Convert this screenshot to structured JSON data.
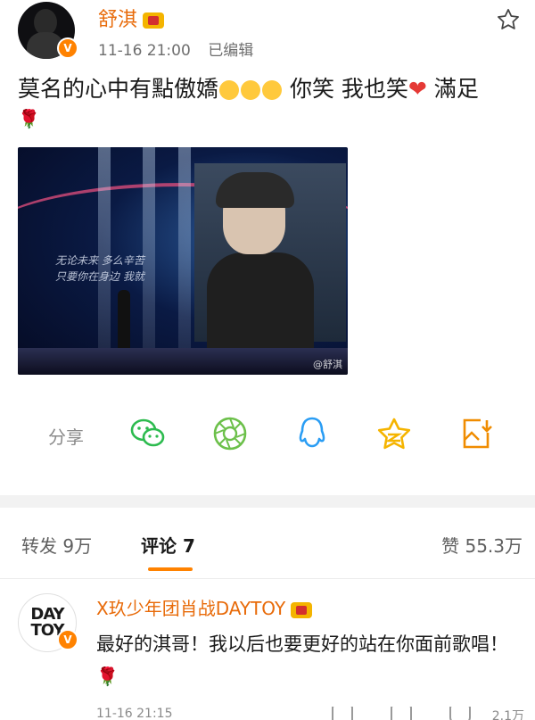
{
  "post": {
    "author": "舒淇",
    "verified_badge": "V",
    "time": "11-16 21:00",
    "edited": "已编辑",
    "text_line": "莫名的心中有點傲嬌",
    "text_mid": "你笑 我也笑",
    "text_end": "滿足",
    "rose": "🌹",
    "image_watermark": "@舒淇",
    "image_lyrics_1": "无论未来 多么辛苦",
    "image_lyrics_2": "只要你在身边 我就"
  },
  "share": {
    "label": "分享",
    "icons": [
      "wechat-icon",
      "moments-icon",
      "qq-icon",
      "qzone-icon",
      "save-image-icon"
    ]
  },
  "tabs": {
    "repost": "转发 9万",
    "comments": "评论 7",
    "likes": "赞 55.3万"
  },
  "comment": {
    "author": "X玖少年团肖战DAYTOY",
    "avatar_line1": "DAY",
    "avatar_line2": "TOY",
    "verified_badge": "V",
    "text": "最好的淇哥！我以后也要更好的站在你面前歌唱！",
    "rose": "🌹",
    "time": "11-16 21:15",
    "likes": "2.1万"
  },
  "colors": {
    "accent": "#ff8200",
    "author": "#e86b0a",
    "muted": "#8a8a8a"
  }
}
